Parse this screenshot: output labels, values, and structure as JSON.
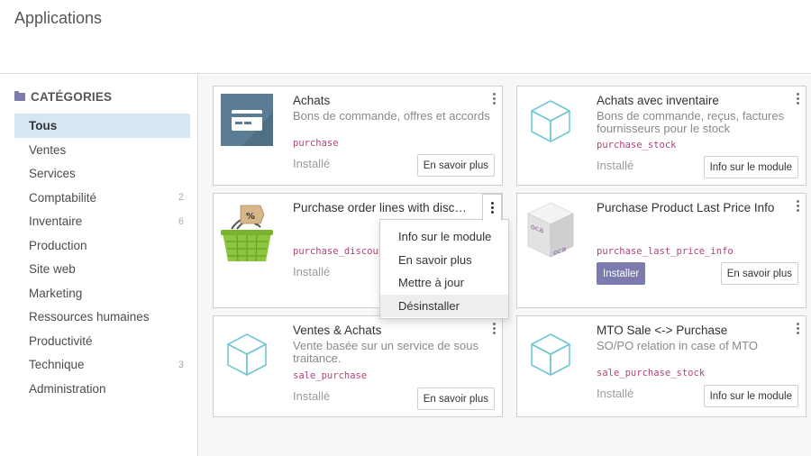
{
  "app": {
    "title": "Applications"
  },
  "sidebar": {
    "header": "CATÉGORIES",
    "items": [
      {
        "label": "Tous",
        "count": ""
      },
      {
        "label": "Ventes",
        "count": ""
      },
      {
        "label": "Services",
        "count": ""
      },
      {
        "label": "Comptabilité",
        "count": "2"
      },
      {
        "label": "Inventaire",
        "count": "6"
      },
      {
        "label": "Production",
        "count": ""
      },
      {
        "label": "Site web",
        "count": ""
      },
      {
        "label": "Marketing",
        "count": ""
      },
      {
        "label": "Ressources humaines",
        "count": ""
      },
      {
        "label": "Productivité",
        "count": ""
      },
      {
        "label": "Technique",
        "count": "3"
      },
      {
        "label": "Administration",
        "count": ""
      }
    ]
  },
  "cards": [
    {
      "title": "Achats",
      "summary": "Bons de commande, offres et accords",
      "tech": "purchase",
      "status": "Installé",
      "button": "En savoir plus",
      "icon": "credit-card-icon"
    },
    {
      "title": "Achats avec inventaire",
      "summary": "Bons de commande, reçus, factures fournisseurs pour le stock",
      "tech": "purchase_stock",
      "status": "Installé",
      "button": "Info sur le module",
      "icon": "cube-icon"
    },
    {
      "title": "Purchase order lines with discou…",
      "summary": "",
      "tech": "purchase_discount",
      "status": "Installé",
      "button": "",
      "icon": "discount-basket-icon"
    },
    {
      "title": "Purchase Product Last Price Info",
      "summary": "",
      "tech": "purchase_last_price_info",
      "install": "Installer",
      "button": "En savoir plus",
      "icon": "oca-box-icon"
    },
    {
      "title": "Ventes & Achats",
      "summary": "Vente basée sur un service de sous traitance.",
      "tech": "sale_purchase",
      "status": "Installé",
      "button": "En savoir plus",
      "icon": "cube-icon"
    },
    {
      "title": "MTO Sale <-> Purchase",
      "summary": "SO/PO relation in case of MTO",
      "tech": "sale_purchase_stock",
      "status": "Installé",
      "button": "Info sur le module",
      "icon": "cube-icon"
    }
  ],
  "dropdown": {
    "items": [
      {
        "label": "Info sur le module"
      },
      {
        "label": "En savoir plus"
      },
      {
        "label": "Mettre à jour"
      },
      {
        "label": "Désinstaller"
      }
    ]
  },
  "colors": {
    "accent": "#7c7bad",
    "active_bg": "#d6e7f4",
    "tech_name": "#b0447e",
    "cube": "#71c8d3"
  }
}
